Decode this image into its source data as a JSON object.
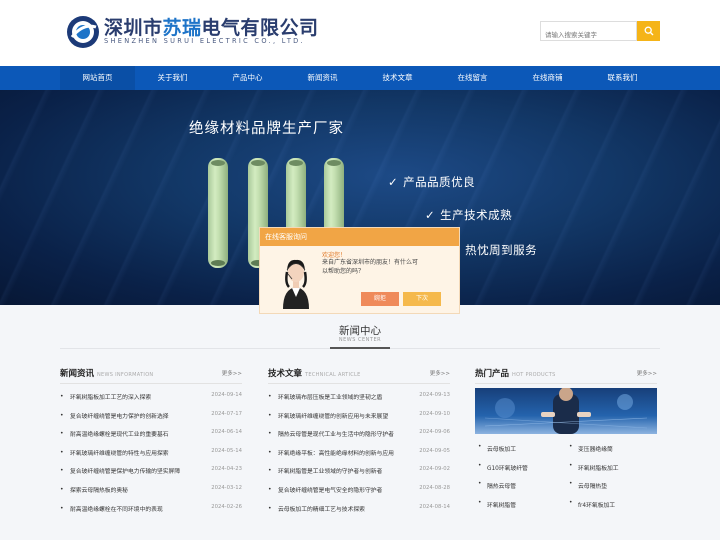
{
  "header": {
    "logo_cn_a": "深圳市",
    "logo_cn_b": "苏瑞",
    "logo_cn_c": "电气有限公司",
    "logo_en": "SHENZHEN SURUI ELECTRIC CO., LTD.",
    "search_placeholder": "请输入搜索关键字",
    "accent": "#0c58b8",
    "search_button_color": "#f5b418"
  },
  "nav": [
    "网站首页",
    "关于我们",
    "产品中心",
    "新闻资讯",
    "技术文章",
    "在线留言",
    "在线商铺",
    "联系我们"
  ],
  "banner": {
    "title": "绝缘材料品牌生产厂家",
    "features": [
      "产品品质优良",
      "生产技术成熟",
      "热忱周到服务"
    ]
  },
  "chat": {
    "title": "在线客服询问",
    "greeting": "欢迎您！",
    "message": "来自广东省深圳市的朋友！有什么可以帮助您的吗？",
    "decline": "婉拒",
    "later": "下次"
  },
  "section": {
    "title": "新闻中心",
    "subtitle": "NEWS CENTER"
  },
  "columns": {
    "news": {
      "title": "新闻资讯",
      "en": "NEWS INFORMATION",
      "more": "更多>>",
      "items": [
        {
          "title": "环氧树脂板加工工艺的深入探索",
          "date": "2024-09-14"
        },
        {
          "title": "复合玻纤缠绕管是电力保护的创新选择",
          "date": "2024-07-17"
        },
        {
          "title": "耐高温绝缘螺栓是现代工业的重要基石",
          "date": "2024-06-14"
        },
        {
          "title": "环氧玻璃纤维缠绕管的特性与应用探索",
          "date": "2024-05-14"
        },
        {
          "title": "复合玻纤缠绕管是保护电力传输的坚实屏障",
          "date": "2024-04-23"
        },
        {
          "title": "探索云母隔热板的奥秘",
          "date": "2024-03-12"
        },
        {
          "title": "耐高温绝缘螺栓在不同环境中的表现",
          "date": "2024-02-26"
        }
      ]
    },
    "tech": {
      "title": "技术文章",
      "en": "TECHNICAL ARTICLE",
      "more": "更多>>",
      "items": [
        {
          "title": "环氧玻璃布层压板是工业领域的坚韧之盾",
          "date": "2024-09-13"
        },
        {
          "title": "环氧玻璃纤维缠绕管的创新应用与未来展望",
          "date": "2024-09-10"
        },
        {
          "title": "隔热云母管是现代工业与生活中的隐形守护者",
          "date": "2024-09-06"
        },
        {
          "title": "环氧绝缘平板：高性能绝缘材料的创新与应用",
          "date": "2024-09-05"
        },
        {
          "title": "环氧树脂管是工业领域的守护者与创新者",
          "date": "2024-09-02"
        },
        {
          "title": "复合玻纤缠绕管是电气安全的隐形守护者",
          "date": "2024-08-28"
        },
        {
          "title": "云母板加工的精细工艺与技术探索",
          "date": "2024-08-14"
        }
      ]
    },
    "products": {
      "title": "热门产品",
      "en": "HOT PRODUCTS",
      "more": "更多>>",
      "items": [
        "云母板加工",
        "变压器绝缘筒",
        "G10环氧玻纤管",
        "环氧树脂板加工",
        "隔热云母管",
        "云母隔热垫",
        "环氧树脂管",
        "fr4环氧板加工"
      ]
    }
  }
}
